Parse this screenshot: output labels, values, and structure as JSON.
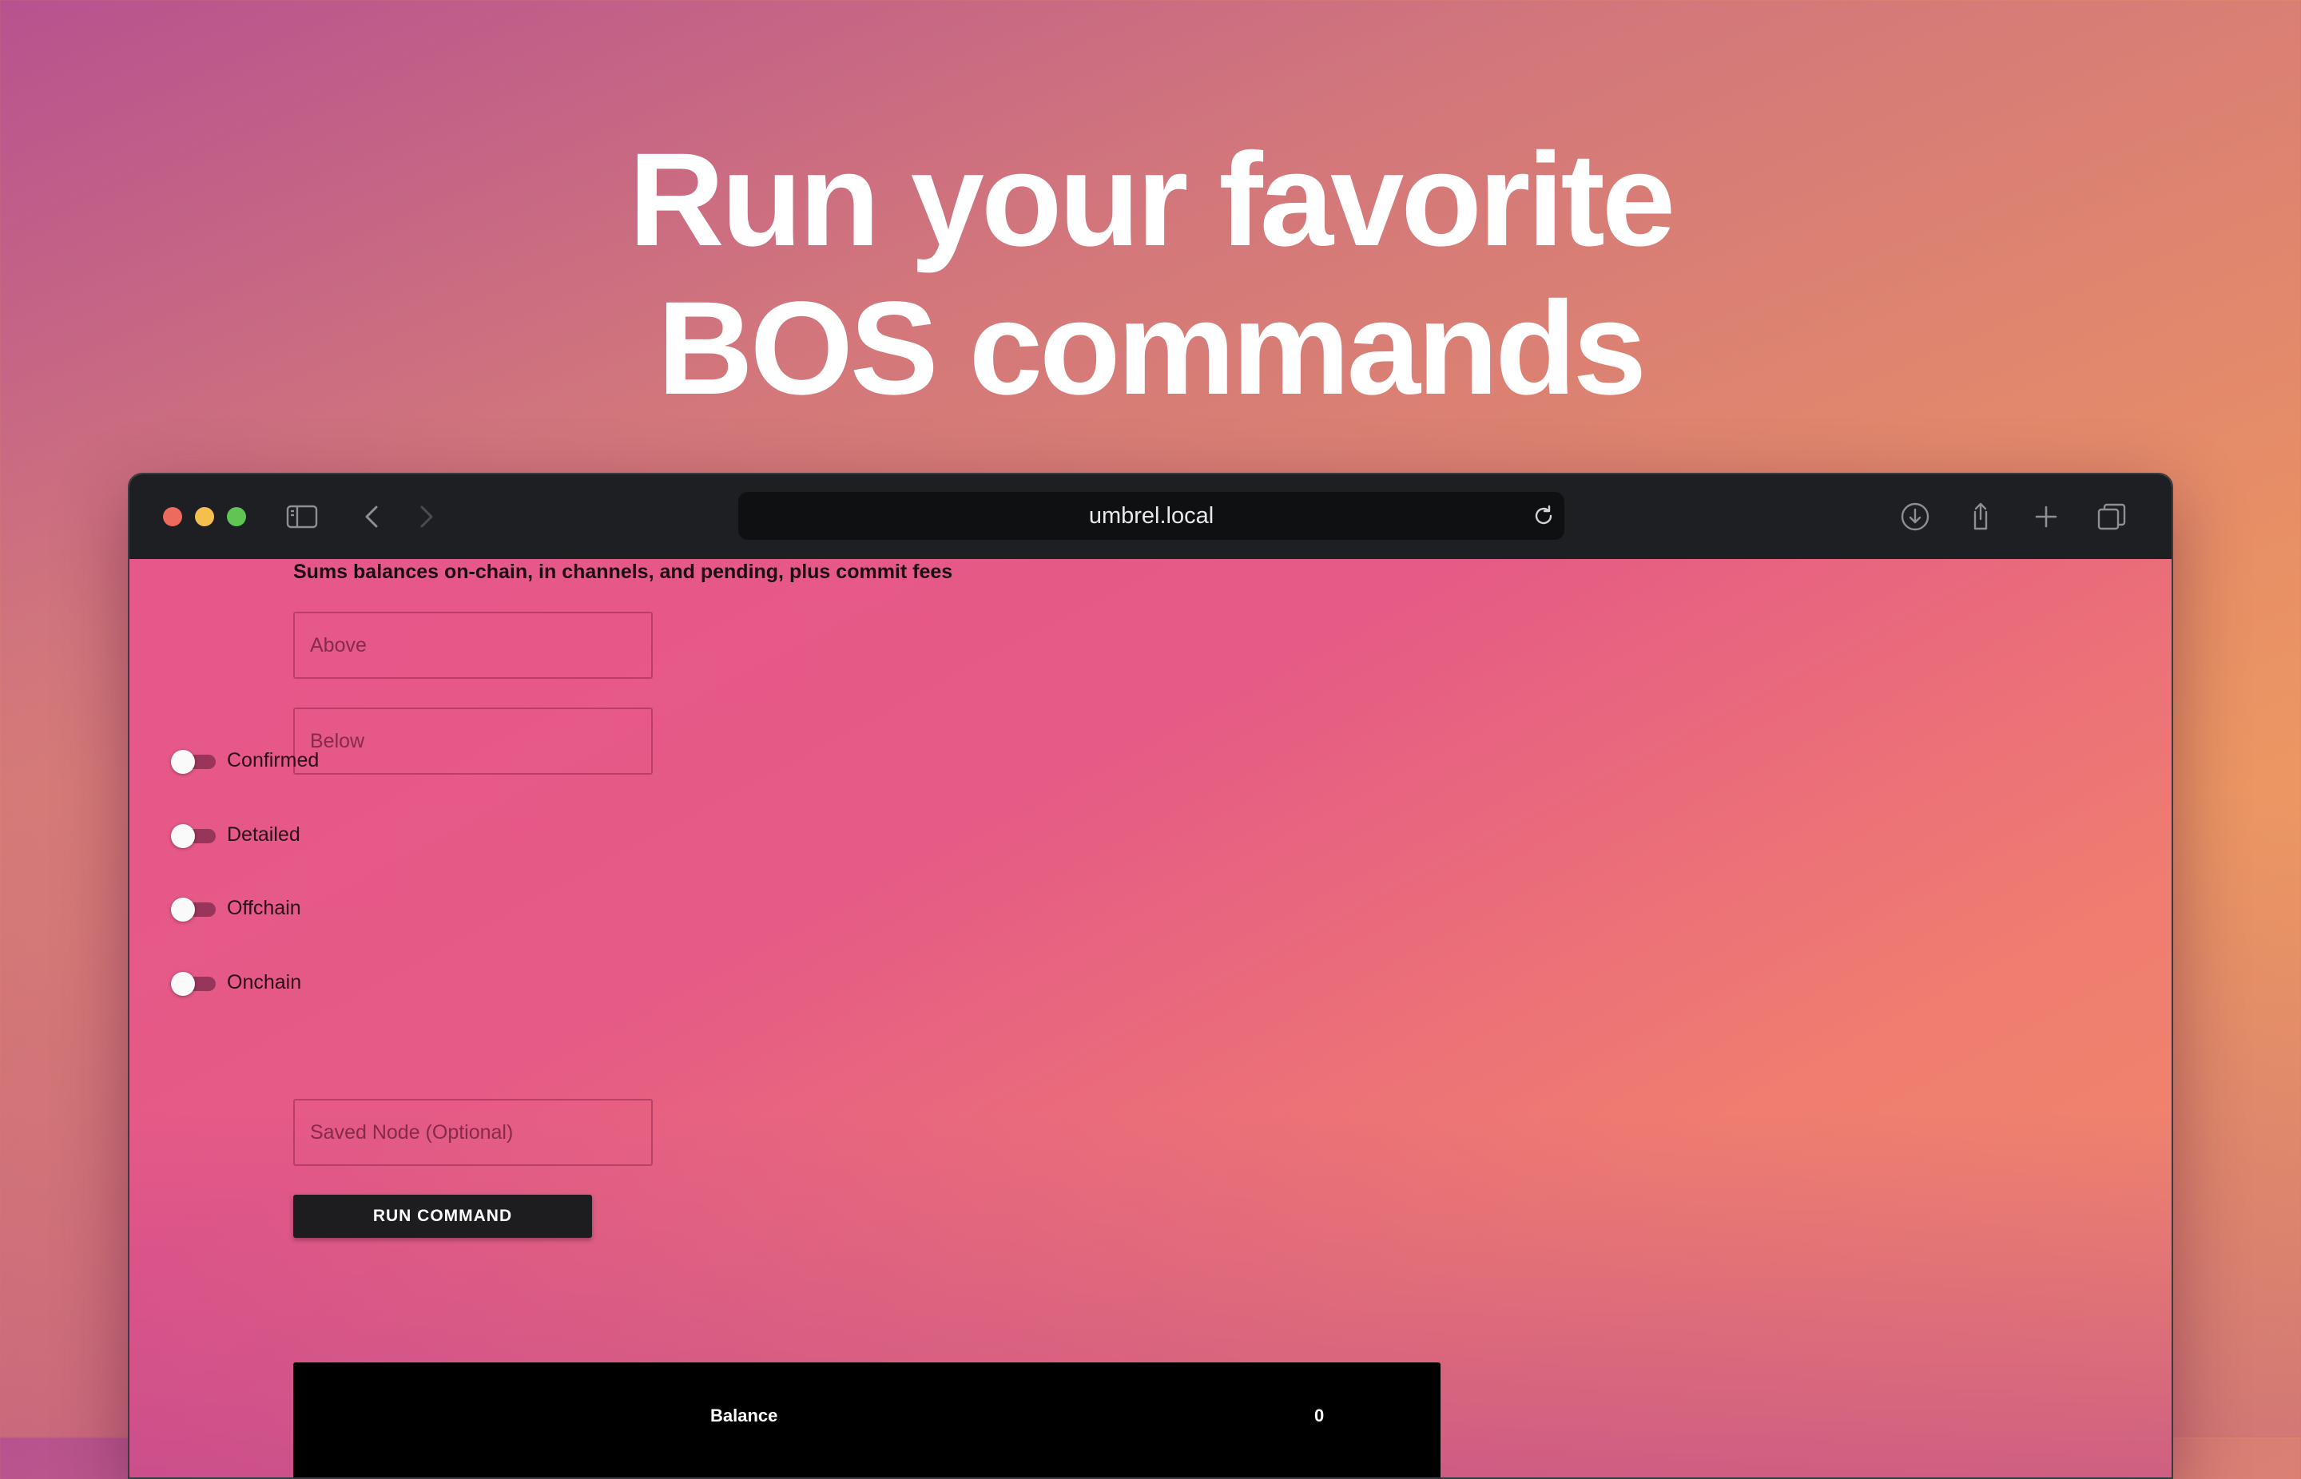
{
  "hero": {
    "title_line1": "Run your favorite",
    "title_line2": "BOS commands"
  },
  "browser": {
    "url": "umbrel.local",
    "toolbar_icons": [
      "sidebar-icon",
      "back-icon",
      "forward-icon",
      "reload-icon",
      "download-icon",
      "share-icon",
      "new-tab-icon",
      "tabs-overview-icon"
    ]
  },
  "form": {
    "description": "Sums balances on-chain, in channels, and pending, plus commit fees",
    "above_placeholder": "Above",
    "below_placeholder": "Below",
    "toggles": {
      "confirmed": "Confirmed",
      "detailed": "Detailed",
      "offchain": "Offchain",
      "onchain": "Onchain"
    },
    "saved_node_placeholder": "Saved Node (Optional)",
    "run_button": "RUN COMMAND"
  },
  "result": {
    "key": "Balance",
    "value": "0"
  },
  "colors": {
    "traffic_red": "#ed6a5e",
    "traffic_yellow": "#f5bf4f",
    "traffic_green": "#61c554",
    "titlebar": "#1e1f22",
    "button": "#1d1d1f"
  }
}
